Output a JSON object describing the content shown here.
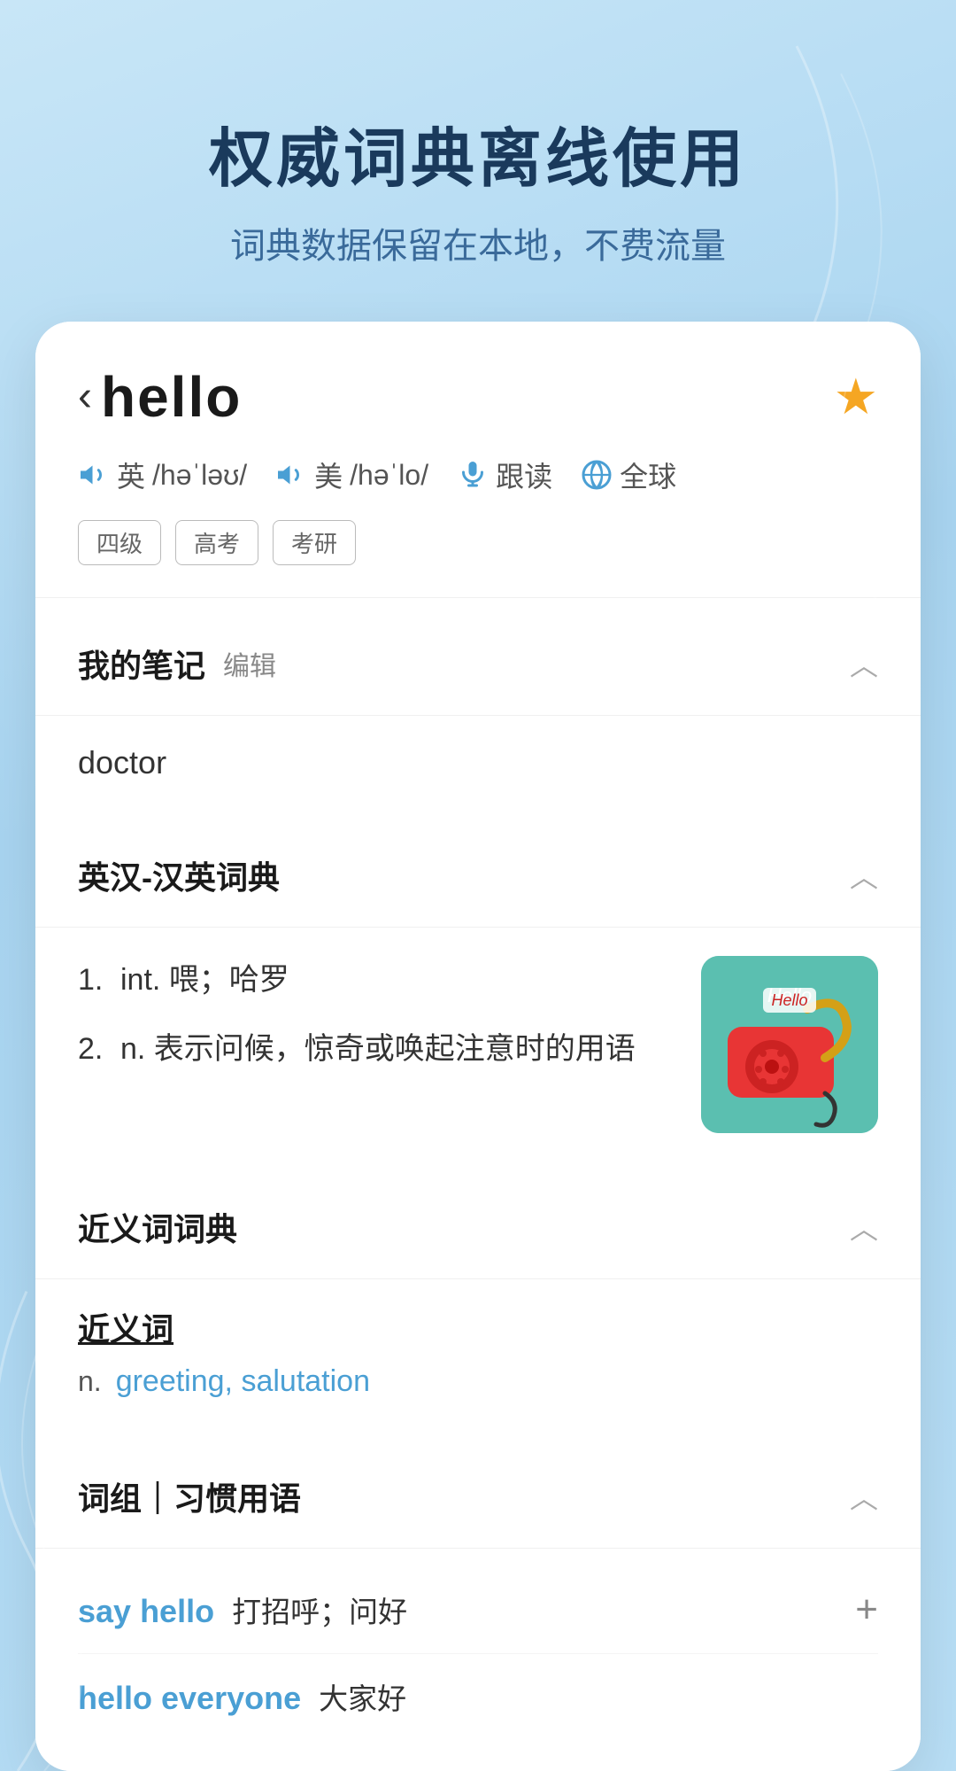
{
  "background": {
    "gradient_start": "#c8e6f7",
    "gradient_end": "#b8def5"
  },
  "hero": {
    "title": "权威词典离线使用",
    "subtitle": "词典数据保留在本地，不费流量"
  },
  "word_card": {
    "back_label": "‹",
    "word": "hello",
    "star": "★",
    "pronunciations": [
      {
        "flag": "英",
        "ipa": "/həˈləʊ/"
      },
      {
        "flag": "美",
        "ipa": "/həˈlo/"
      }
    ],
    "follow_read": "跟读",
    "global": "全球",
    "tags": [
      "四级",
      "高考",
      "考研"
    ]
  },
  "notes_section": {
    "title": "我的笔记",
    "edit_label": "编辑",
    "content": "doctor",
    "collapsed": false
  },
  "definition_section": {
    "title": "英汉-汉英词典",
    "definitions": [
      {
        "num": "1.",
        "pos": "int.",
        "text": "喂；哈罗"
      },
      {
        "num": "2.",
        "pos": "n.",
        "text": "表示问候，惊奇或唤起注意时的用语"
      }
    ]
  },
  "synonym_section": {
    "title": "近义词词典",
    "synonym_group_title": "近义词",
    "pos": "n.",
    "synonyms": "greeting, salutation"
  },
  "phrase_section": {
    "title": "词组｜习惯用语",
    "phrases": [
      {
        "word": "say hello",
        "meaning": "打招呼；问好"
      },
      {
        "word": "hello everyone",
        "meaning": "大家好"
      }
    ]
  }
}
